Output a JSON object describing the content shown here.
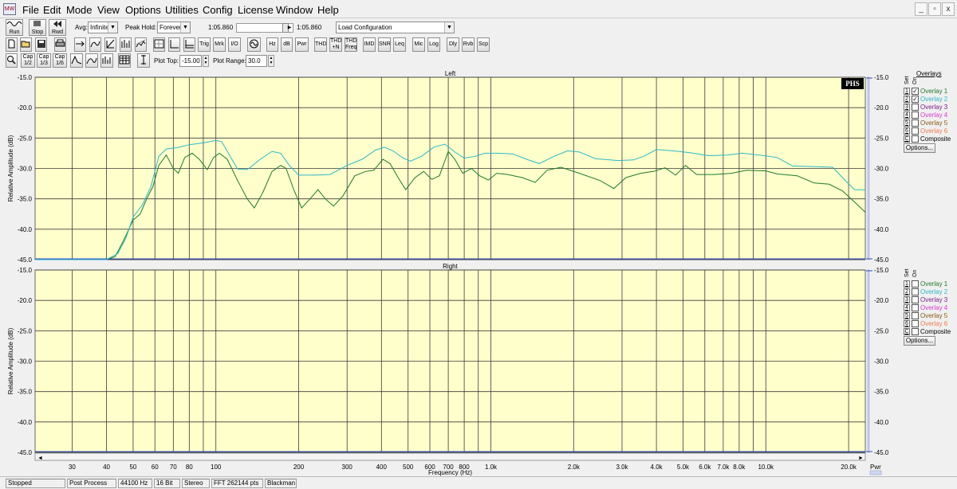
{
  "app": {
    "icon_text": "MW"
  },
  "menu": [
    "File",
    "Edit",
    "Mode",
    "View",
    "Options",
    "Utilities",
    "Config",
    "License",
    "Window",
    "Help"
  ],
  "window_buttons": [
    "_",
    "▫",
    "x"
  ],
  "toolbar1": {
    "run": "Run",
    "stop": "Stop",
    "rwd": "Rwd",
    "avg_label": "Avg:",
    "avg_value": "Infinite",
    "peak_hold_label": "Peak Hold:",
    "peak_hold_value": "Forever",
    "position_start": "1:05.860",
    "position_end": "1:05.860",
    "config_value": "Load Configuration"
  },
  "toolbar2": {
    "buttons": [
      "Trig",
      "Mrk",
      "I/O",
      "Hz",
      "dB",
      "Pwr",
      "THD",
      "THD +N",
      "THD Freq",
      "IMD",
      "SNR",
      "Leq",
      "Mic",
      "Log",
      "Dly",
      "Rvb",
      "Scp"
    ]
  },
  "toolbar3": {
    "cap_buttons": [
      "Cap 1/2",
      "Cap 1/3",
      "Cap 1/6"
    ],
    "plot_top_label": "Plot Top:",
    "plot_top_value": "-15.00",
    "plot_range_label": "Plot Range:",
    "plot_range_value": "30.0"
  },
  "colors": {
    "plot_bg": "#ffffcc",
    "grid": "#3a3a3a",
    "overlay1": "#1e7a2a",
    "overlay2": "#2db6c8",
    "overlay3": "#7a1f8c",
    "overlay4": "#d63ad6",
    "overlay5": "#8a5a14",
    "overlay6": "#f07a4a",
    "baseline": "#3050c8"
  },
  "plots": [
    {
      "title": "Left",
      "ylabel": "Relative Amplitude (dB)",
      "logo": "PHS"
    },
    {
      "title": "Right",
      "ylabel": "Relative Amplitude (dB)",
      "logo": ""
    }
  ],
  "x_ticks": [
    "30",
    "40",
    "50",
    "60",
    "70",
    "80",
    "100",
    "200",
    "300",
    "400",
    "500",
    "600",
    "700",
    "800",
    "1.0k",
    "2.0k",
    "3.0k",
    "4.0k",
    "5.0k",
    "6.0k",
    "7.0k",
    "8.0k",
    "10.0k",
    "20.0k"
  ],
  "y_ticks": [
    "-15.0",
    "-20.0",
    "-25.0",
    "-30.0",
    "-35.0",
    "-40.0",
    "-45.0"
  ],
  "xlabel": "Frequency (Hz)",
  "pwr_label": "Pwr",
  "overlays_header": "Overlays",
  "set_label": "Set",
  "on_label": "On",
  "overlays_left": [
    {
      "num": "1",
      "name": "Overlay 1",
      "checked": "✓"
    },
    {
      "num": "2",
      "name": "Overlay 2",
      "checked": "✓"
    },
    {
      "num": "3",
      "name": "Overlay 3",
      "checked": ""
    },
    {
      "num": "4",
      "name": "Overlay 4",
      "checked": ""
    },
    {
      "num": "5",
      "name": "Overlay 5",
      "checked": ""
    },
    {
      "num": "6",
      "name": "Overlay 6",
      "checked": ""
    },
    {
      "num": "C",
      "name": "Composite",
      "checked": ""
    }
  ],
  "overlays_right": [
    {
      "num": "1",
      "name": "Overlay 1",
      "checked": ""
    },
    {
      "num": "2",
      "name": "Overlay 2",
      "checked": ""
    },
    {
      "num": "3",
      "name": "Overlay 3",
      "checked": ""
    },
    {
      "num": "4",
      "name": "Overlay 4",
      "checked": ""
    },
    {
      "num": "5",
      "name": "Overlay 5",
      "checked": ""
    },
    {
      "num": "6",
      "name": "Overlay 6",
      "checked": ""
    },
    {
      "num": "C",
      "name": "Composite",
      "checked": ""
    }
  ],
  "options_label": "Options...",
  "status": [
    "Stopped",
    "Post Process",
    "44100 Hz",
    "16 Bit",
    "Stereo",
    "FFT 262144 pts",
    "Blackman"
  ],
  "chart_data": [
    {
      "type": "line",
      "title": "Left",
      "xlabel": "Frequency (Hz)",
      "ylabel": "Relative Amplitude (dB)",
      "x_scale": "log",
      "xlim": [
        22,
        23000
      ],
      "ylim": [
        -45,
        -15
      ],
      "grid": true,
      "series": [
        {
          "name": "Overlay 1",
          "color": "#1e7a2a",
          "points": [
            [
              22,
              -45
            ],
            [
              40,
              -45
            ],
            [
              43,
              -44.5
            ],
            [
              46,
              -42
            ],
            [
              50,
              -38.5
            ],
            [
              53,
              -37.5
            ],
            [
              56,
              -35
            ],
            [
              59,
              -33
            ],
            [
              62,
              -29.5
            ],
            [
              66,
              -27.8
            ],
            [
              70,
              -30
            ],
            [
              73,
              -30.8
            ],
            [
              77,
              -28.2
            ],
            [
              82,
              -27.5
            ],
            [
              87,
              -28.5
            ],
            [
              93,
              -30.2
            ],
            [
              98,
              -28.2
            ],
            [
              103,
              -27.5
            ],
            [
              110,
              -28.5
            ],
            [
              120,
              -32
            ],
            [
              130,
              -35
            ],
            [
              138,
              -36.5
            ],
            [
              148,
              -34
            ],
            [
              160,
              -30.5
            ],
            [
              172,
              -29.5
            ],
            [
              180,
              -30
            ],
            [
              192,
              -33.5
            ],
            [
              205,
              -36.5
            ],
            [
              220,
              -35
            ],
            [
              235,
              -33.5
            ],
            [
              250,
              -35
            ],
            [
              268,
              -36.2
            ],
            [
              290,
              -34.5
            ],
            [
              320,
              -31.2
            ],
            [
              350,
              -30.5
            ],
            [
              375,
              -30.3
            ],
            [
              405,
              -28.5
            ],
            [
              430,
              -29.2
            ],
            [
              460,
              -31.5
            ],
            [
              490,
              -33.5
            ],
            [
              530,
              -31.5
            ],
            [
              570,
              -30.5
            ],
            [
              610,
              -31.8
            ],
            [
              650,
              -31.2
            ],
            [
              700,
              -27.2
            ],
            [
              740,
              -28.5
            ],
            [
              790,
              -30.8
            ],
            [
              850,
              -30
            ],
            [
              910,
              -31.2
            ],
            [
              980,
              -31.9
            ],
            [
              1050,
              -30.8
            ],
            [
              1150,
              -31
            ],
            [
              1300,
              -31.5
            ],
            [
              1450,
              -32.3
            ],
            [
              1600,
              -30.3
            ],
            [
              1800,
              -29.8
            ],
            [
              2100,
              -30.8
            ],
            [
              2500,
              -32
            ],
            [
              2800,
              -33.3
            ],
            [
              3100,
              -31.5
            ],
            [
              3500,
              -30.8
            ],
            [
              3900,
              -30.5
            ],
            [
              4300,
              -29.9
            ],
            [
              4700,
              -31.1
            ],
            [
              5100,
              -29.5
            ],
            [
              5600,
              -31
            ],
            [
              6500,
              -31
            ],
            [
              7500,
              -30.8
            ],
            [
              8500,
              -30.3
            ],
            [
              10000,
              -30.4
            ],
            [
              11000,
              -30.9
            ],
            [
              13000,
              -31.2
            ],
            [
              15000,
              -32.4
            ],
            [
              17000,
              -32.6
            ],
            [
              19000,
              -33.7
            ],
            [
              21000,
              -35.5
            ],
            [
              23000,
              -37.2
            ]
          ]
        },
        {
          "name": "Overlay 2",
          "color": "#2db6c8",
          "points": [
            [
              22,
              -45
            ],
            [
              40,
              -45
            ],
            [
              44,
              -44
            ],
            [
              47,
              -41.5
            ],
            [
              50,
              -38
            ],
            [
              54,
              -36
            ],
            [
              58,
              -33
            ],
            [
              62,
              -28
            ],
            [
              66,
              -26.8
            ],
            [
              72,
              -26.6
            ],
            [
              80,
              -26.1
            ],
            [
              90,
              -25.8
            ],
            [
              100,
              -25.4
            ],
            [
              105,
              -25.6
            ],
            [
              112,
              -27.8
            ],
            [
              120,
              -30.1
            ],
            [
              130,
              -30.2
            ],
            [
              145,
              -28.5
            ],
            [
              160,
              -27.2
            ],
            [
              172,
              -27.5
            ],
            [
              185,
              -29.5
            ],
            [
              200,
              -31.1
            ],
            [
              230,
              -31.1
            ],
            [
              260,
              -31
            ],
            [
              300,
              -29.5
            ],
            [
              340,
              -28.5
            ],
            [
              380,
              -27
            ],
            [
              410,
              -26.5
            ],
            [
              440,
              -27.1
            ],
            [
              480,
              -28.3
            ],
            [
              510,
              -28.8
            ],
            [
              560,
              -28
            ],
            [
              620,
              -26.5
            ],
            [
              680,
              -26
            ],
            [
              740,
              -27.3
            ],
            [
              800,
              -28.3
            ],
            [
              880,
              -28
            ],
            [
              950,
              -27.5
            ],
            [
              1050,
              -27.5
            ],
            [
              1200,
              -27.6
            ],
            [
              1350,
              -28.5
            ],
            [
              1500,
              -29.2
            ],
            [
              1700,
              -28
            ],
            [
              1900,
              -27.1
            ],
            [
              2100,
              -27.3
            ],
            [
              2400,
              -28.4
            ],
            [
              2900,
              -28.7
            ],
            [
              3300,
              -28.6
            ],
            [
              3600,
              -28
            ],
            [
              4000,
              -26.9
            ],
            [
              4600,
              -27.1
            ],
            [
              5300,
              -27.4
            ],
            [
              6200,
              -27.9
            ],
            [
              7200,
              -27.8
            ],
            [
              8200,
              -27.5
            ],
            [
              9500,
              -27.8
            ],
            [
              11000,
              -28.2
            ],
            [
              12500,
              -29.6
            ],
            [
              15000,
              -29.7
            ],
            [
              17500,
              -29.8
            ],
            [
              19000,
              -31.5
            ],
            [
              21000,
              -33.5
            ],
            [
              23000,
              -33.5
            ]
          ]
        }
      ]
    },
    {
      "type": "line",
      "title": "Right",
      "xlabel": "Frequency (Hz)",
      "ylabel": "Relative Amplitude (dB)",
      "x_scale": "log",
      "xlim": [
        22,
        23000
      ],
      "ylim": [
        -45,
        -15
      ],
      "grid": true,
      "series": []
    }
  ]
}
